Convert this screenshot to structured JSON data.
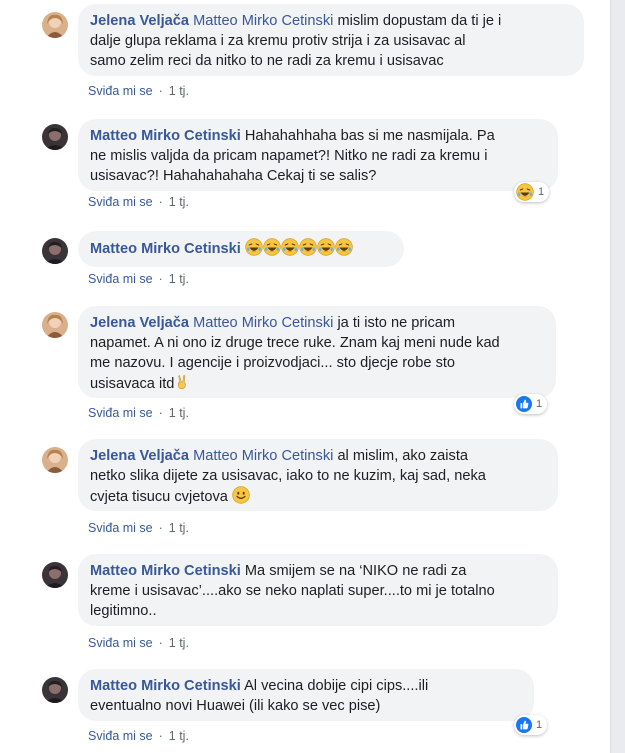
{
  "action_like": "Sviđa mi se",
  "separator": "·",
  "time": "1 tj.",
  "comments": [
    {
      "author": "Jelena Veljača",
      "tag": "Matteo Mirko Cetinski",
      "text_lines": [
        "mislim dopustam da ti je i",
        "dalje glupa reklama i za kremu protiv strija i za usisavac al",
        "samo zelim reci da nitko to ne radi za kremu i usisavac"
      ]
    },
    {
      "author": "Matteo Mirko Cetinski",
      "text_lines": [
        "Hahahahhaha bas si me nasmijala. Pa",
        "ne mislis valjda da pricam napamet?! Nitko ne radi za kremu i",
        "usisavac?! Hahahahahaha Cekaj ti se salis?"
      ],
      "reaction": {
        "icon": "laugh-emoji",
        "count": "1"
      }
    },
    {
      "author": "Matteo Mirko Cetinski",
      "emojis": [
        "laugh-emoji",
        "laugh-emoji",
        "laugh-emoji",
        "laugh-emoji",
        "laugh-emoji",
        "laugh-emoji"
      ]
    },
    {
      "author": "Jelena Veljača",
      "tag": "Matteo Mirko Cetinski",
      "text_lines": [
        "ja ti isto ne pricam",
        "napamet. A ni ono iz druge trece ruke. Znam kaj meni nude kad",
        "me nazovu. I agencije i proizvodjaci... sto djecje robe sto",
        "usisavaca itd"
      ],
      "trailing_emoji": "victory-hand-emoji",
      "reaction": {
        "icon": "like-icon",
        "count": "1"
      }
    },
    {
      "author": "Jelena Veljača",
      "tag": "Matteo Mirko Cetinski",
      "text_lines": [
        "al mislim, ako zaista",
        "netko slika dijete za usisavac, iako to ne kuzim, kaj sad, neka",
        "cvjeta tisucu cvjetova"
      ],
      "trailing_emoji": "smile-emoji"
    },
    {
      "author": "Matteo Mirko Cetinski",
      "text_lines": [
        "Ma smijem se na ‘NIKO ne radi za",
        "kreme i usisavac’....ako se neko naplati super....to mi je totalno",
        "legitimno.."
      ]
    },
    {
      "author": "Matteo Mirko Cetinski",
      "text_lines": [
        "Al vecina dobije cipi cips....ili",
        "eventualno novi Huawei (ili kako se vec pise)"
      ],
      "reaction": {
        "icon": "like-icon",
        "count": "1"
      }
    }
  ]
}
